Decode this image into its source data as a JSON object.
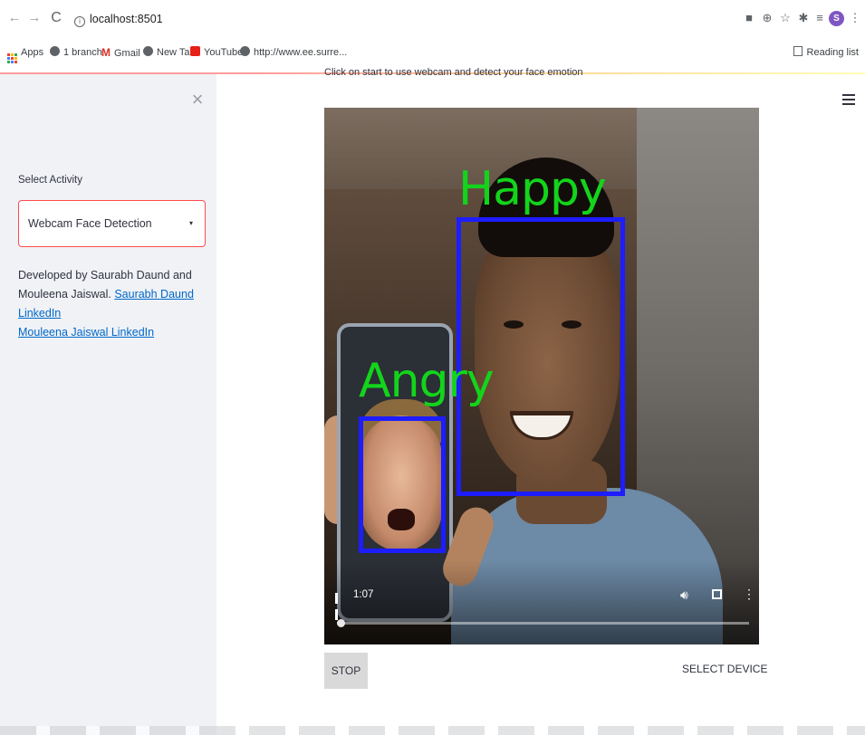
{
  "browser": {
    "back": "←",
    "forward": "→",
    "reload": "C",
    "url": "localhost:8501",
    "profile_initial": "S",
    "bookmarks": [
      {
        "label": "Apps"
      },
      {
        "label": "1 branch"
      },
      {
        "label": "Gmail"
      },
      {
        "label": "New Tab"
      },
      {
        "label": "YouTube"
      },
      {
        "label": "http://www.ee.surre..."
      }
    ],
    "reading_list": "Reading list"
  },
  "sidebar": {
    "close": "×",
    "select_label": "Select Activity",
    "select_value": "Webcam Face Detection",
    "caret": "▾",
    "about_text": "Developed by Saurabh Daund and Mouleena Jaiswal.",
    "link1": "Saurabh Daund LinkedIn",
    "link2": "Mouleena Jaiswal LinkedIn"
  },
  "main": {
    "hint": "Click on start to use webcam and detect your face emotion",
    "video": {
      "time": "1:07",
      "progress": 0.01,
      "detections": [
        {
          "label": "Happy",
          "box_color": "#1d1dff",
          "text_color": "#13d41b"
        },
        {
          "label": "Angry",
          "box_color": "#1d1dff",
          "text_color": "#13d41b"
        }
      ]
    },
    "stop_label": "STOP",
    "select_device_label": "SELECT DEVICE"
  },
  "colors": {
    "accent": "#ff4b4b",
    "link": "#0068c9",
    "sidebar_bg": "#f0f2f6"
  }
}
